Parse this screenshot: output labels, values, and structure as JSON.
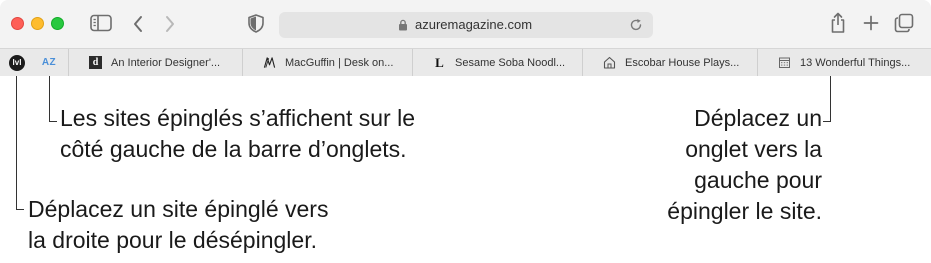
{
  "address_bar": {
    "url": "azuremagazine.com"
  },
  "pinned_tabs": [
    {
      "name": "pinned-site-1",
      "label": "lvl"
    },
    {
      "name": "pinned-site-2",
      "label": "AZ"
    }
  ],
  "tabs": [
    {
      "title": "An Interior Designer'...",
      "favicon": "d"
    },
    {
      "title": "MacGuffin | Desk on...",
      "favicon": "M"
    },
    {
      "title": "Sesame Soba Noodl...",
      "favicon": "L"
    },
    {
      "title": "Escobar House Plays...",
      "favicon": "house-icon"
    },
    {
      "title": "13 Wonderful Things...",
      "favicon": "calendar-icon"
    }
  ],
  "callouts": {
    "pinned_left": [
      "Les sites épinglés s’affichent sur le",
      "côté gauche de la barre d’onglets."
    ],
    "unpin": [
      "Déplacez un site épinglé vers",
      "la droite pour le désépingler."
    ],
    "pin": [
      "Déplacez un",
      "onglet vers la",
      "gauche pour",
      "épingler le site."
    ]
  },
  "colors": {
    "close": "#fe5f57",
    "minimize": "#febc2e",
    "zoom": "#28c840",
    "az_accent": "#4a8fd8"
  }
}
